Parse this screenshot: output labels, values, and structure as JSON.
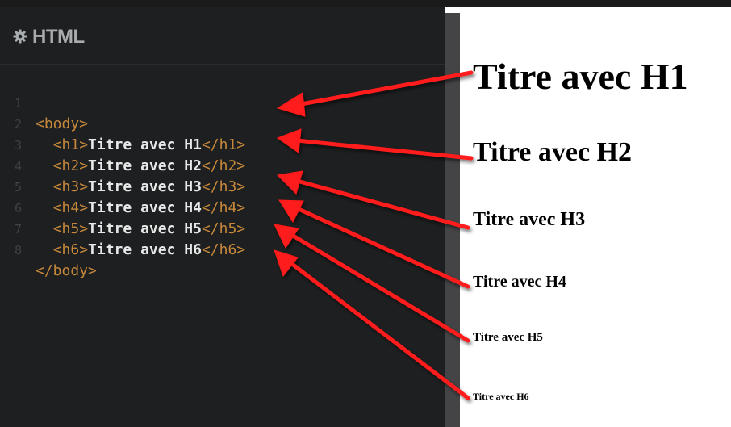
{
  "editor": {
    "title": "HTML",
    "icon": "gear-icon",
    "lines": [
      {
        "num": "1",
        "indent": "",
        "open": "<body>",
        "text": "",
        "close": ""
      },
      {
        "num": "2",
        "indent": "  ",
        "open": "<h1>",
        "text": "Titre avec H1",
        "close": "</h1>"
      },
      {
        "num": "3",
        "indent": "  ",
        "open": "<h2>",
        "text": "Titre avec H2",
        "close": "</h2>"
      },
      {
        "num": "4",
        "indent": "  ",
        "open": "<h3>",
        "text": "Titre avec H3",
        "close": "</h3>"
      },
      {
        "num": "5",
        "indent": "  ",
        "open": "<h4>",
        "text": "Titre avec H4",
        "close": "</h4>"
      },
      {
        "num": "6",
        "indent": "  ",
        "open": "<h5>",
        "text": "Titre avec H5",
        "close": "</h5>"
      },
      {
        "num": "7",
        "indent": "  ",
        "open": "<h6>",
        "text": "Titre avec H6",
        "close": "</h6>"
      },
      {
        "num": "8",
        "indent": "",
        "open": "</body>",
        "text": "",
        "close": ""
      }
    ]
  },
  "preview": {
    "h1": "Titre avec H1",
    "h2": "Titre avec H2",
    "h3": "Titre avec H3",
    "h4": "Titre avec H4",
    "h5": "Titre avec H5",
    "h6": "Titre avec H6"
  },
  "colors": {
    "editor_bg": "#1d1f20",
    "tag": "#c6883b",
    "code_text": "#e8e8e8",
    "arrow": "#ff1a1a"
  }
}
